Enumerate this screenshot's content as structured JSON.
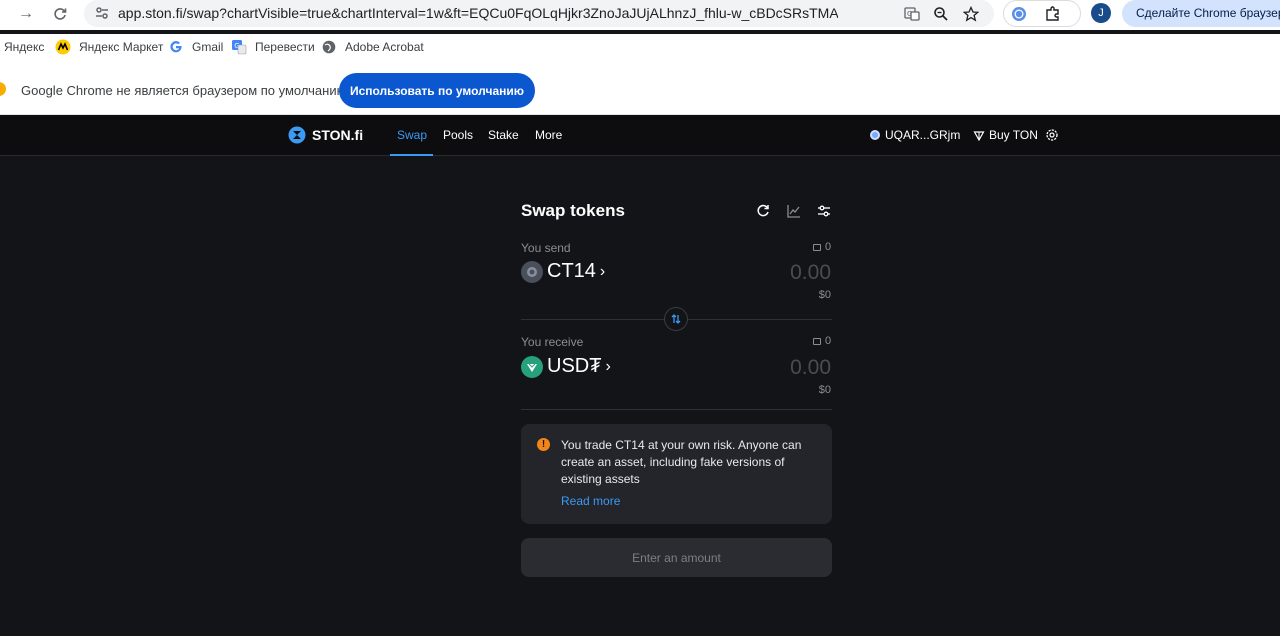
{
  "browser": {
    "url": "app.ston.fi/swap?chartVisible=true&chartInterval=1w&ft=EQCu0FqOLqHjkr3ZnoJaJUjALhnzJ_fhlu-w_cBDcSRsTMAq&tt=USD₮",
    "profile_initial": "J",
    "default_browser_button": "Сделайте Chrome браузером"
  },
  "bookmarks": [
    {
      "label": "Яндекс",
      "icon": "yandex-icon"
    },
    {
      "label": "Яндекс Маркет",
      "icon": "yandex-market-icon"
    },
    {
      "label": "Gmail",
      "icon": "google-icon"
    },
    {
      "label": "Перевести",
      "icon": "translate-icon"
    },
    {
      "label": "Adobe Acrobat",
      "icon": "globe-icon"
    }
  ],
  "infobar": {
    "message": "Google Chrome не является браузером по умолчанию.",
    "button": "Использовать по умолчанию"
  },
  "app": {
    "logo": "STON.fi",
    "nav": [
      "Swap",
      "Pools",
      "Stake",
      "More"
    ],
    "active_nav": "Swap",
    "wallet": "UQAR...GRjm",
    "buy": "Buy TON",
    "swap_title": "Swap tokens",
    "send": {
      "label": "You send",
      "balance": "0",
      "token": "CT14",
      "amount": "0.00",
      "usd": "$0"
    },
    "receive": {
      "label": "You receive",
      "balance": "0",
      "token": "USD₮",
      "amount": "0.00",
      "usd": "$0"
    },
    "warning": {
      "text": "You trade CT14 at your own risk. Anyone can create an asset, including fake versions of existing assets",
      "link": "Read more"
    },
    "submit": "Enter an amount",
    "colors": {
      "accent": "#3b9af2",
      "background": "#131417",
      "warning": "#f2841a",
      "usdt": "#26a17b"
    }
  }
}
